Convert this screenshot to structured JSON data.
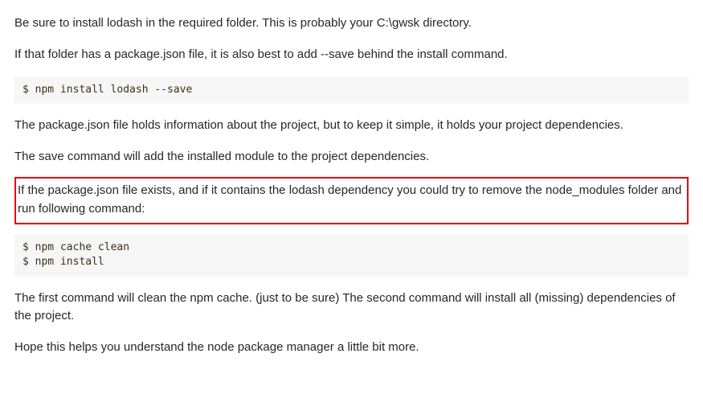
{
  "paragraphs": {
    "p1": "Be sure to install lodash in the required folder. This is probably your C:\\gwsk directory.",
    "p2": "If that folder has a package.json file, it is also best to add --save behind the install command.",
    "p3": "The package.json file holds information about the project, but to keep it simple, it holds your project dependencies.",
    "p4": "The save command will add the installed module to the project dependencies.",
    "p5": "If the package.json file exists, and if it contains the lodash dependency you could try to remove the node_modules folder and run following command:",
    "p6": "The first command will clean the npm cache. (just to be sure) The second command will install all (missing) dependencies of the project.",
    "p7": "Hope this helps you understand the node package manager a little bit more."
  },
  "code": {
    "c1": "$ npm install lodash --save",
    "c2": "$ npm cache clean\n$ npm install"
  }
}
